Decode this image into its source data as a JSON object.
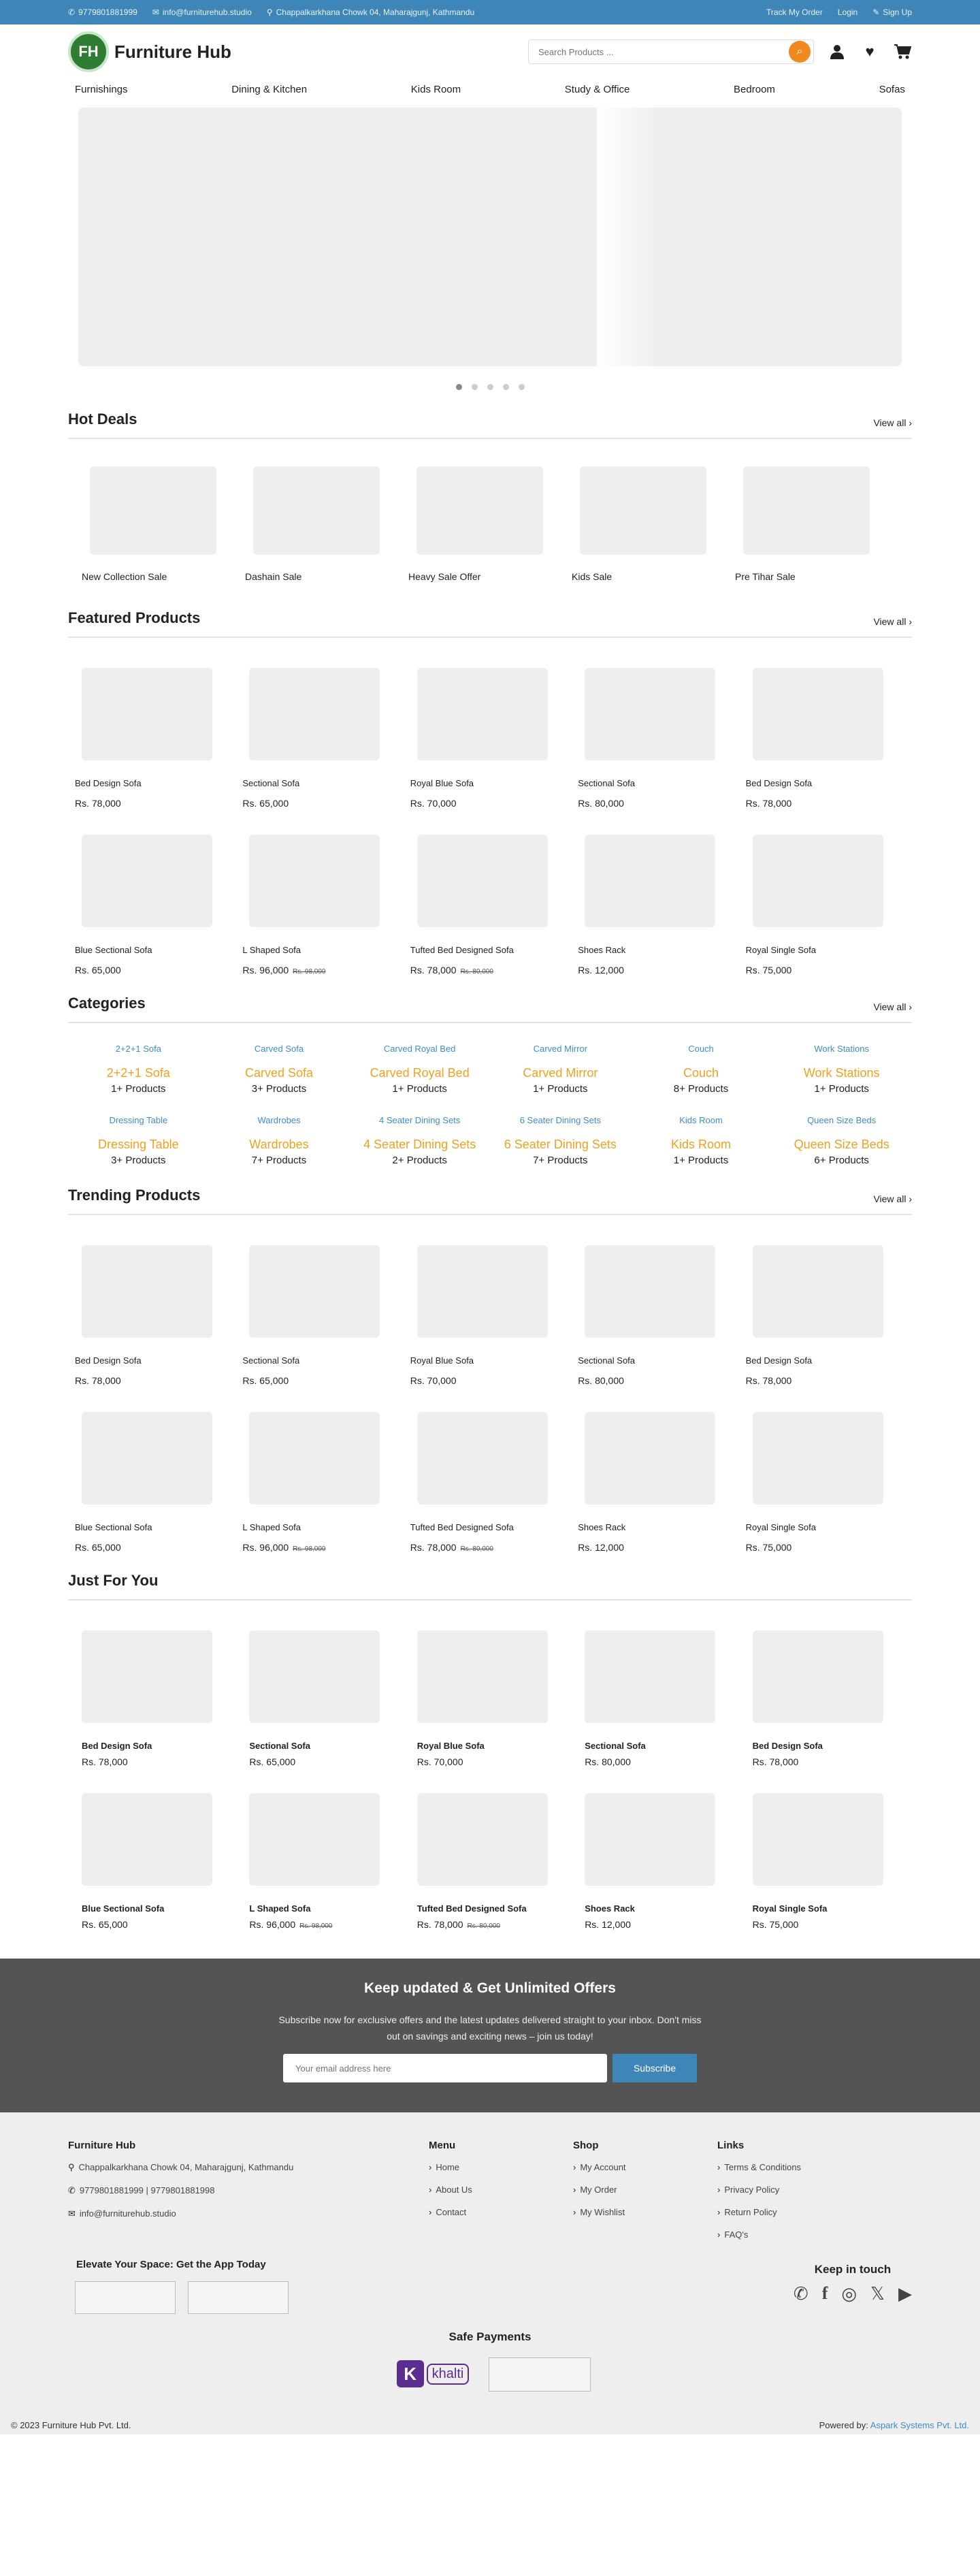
{
  "topbar": {
    "phone": "9779801881999",
    "email": "info@furniturehub.studio",
    "address": "Chappalkarkhana Chowk 04, Maharajgunj, Kathmandu",
    "track": "Track My Order",
    "login": "Login",
    "signup": "Sign Up"
  },
  "header": {
    "logo_mark": "FH",
    "logo_text": "Furniture Hub",
    "search_placeholder": "Search Products ..."
  },
  "nav": [
    "Furnishings",
    "Dining & Kitchen",
    "Kids Room",
    "Study & Office",
    "Bedroom",
    "Sofas"
  ],
  "hot_deals": {
    "title": "Hot Deals",
    "view_all": "View all",
    "items": [
      "New Collection Sale",
      "Dashain Sale",
      "Heavy Sale Offer",
      "Kids Sale",
      "Pre Tihar Sale"
    ]
  },
  "featured": {
    "title": "Featured Products",
    "view_all": "View all",
    "items": [
      {
        "name": "Bed Design Sofa",
        "price": "Rs. 78,000",
        "old": ""
      },
      {
        "name": "Sectional Sofa",
        "price": "Rs. 65,000",
        "old": ""
      },
      {
        "name": "Royal Blue Sofa",
        "price": "Rs. 70,000",
        "old": ""
      },
      {
        "name": "Sectional Sofa",
        "price": "Rs. 80,000",
        "old": ""
      },
      {
        "name": "Bed Design Sofa",
        "price": "Rs. 78,000",
        "old": ""
      },
      {
        "name": "Blue Sectional Sofa",
        "price": "Rs. 65,000",
        "old": ""
      },
      {
        "name": "L Shaped Sofa",
        "price": "Rs. 96,000",
        "old": "Rs. 98,000"
      },
      {
        "name": "Tufted Bed Designed Sofa",
        "price": "Rs. 78,000",
        "old": "Rs. 80,000"
      },
      {
        "name": "Shoes Rack",
        "price": "Rs. 12,000",
        "old": ""
      },
      {
        "name": "Royal Single Sofa",
        "price": "Rs. 75,000",
        "old": ""
      }
    ]
  },
  "categories": {
    "title": "Categories",
    "view_all": "View all",
    "items": [
      {
        "name": "2+2+1 Sofa",
        "count": "1+ Products"
      },
      {
        "name": "Carved Sofa",
        "count": "3+ Products"
      },
      {
        "name": "Carved Royal Bed",
        "count": "1+ Products"
      },
      {
        "name": "Carved Mirror",
        "count": "1+ Products"
      },
      {
        "name": "Couch",
        "count": "8+ Products"
      },
      {
        "name": "Work Stations",
        "count": "1+ Products"
      },
      {
        "name": "Dressing Table",
        "count": "3+ Products"
      },
      {
        "name": "Wardrobes",
        "count": "7+ Products"
      },
      {
        "name": "4 Seater Dining Sets",
        "count": "2+ Products"
      },
      {
        "name": "6 Seater Dining Sets",
        "count": "7+ Products"
      },
      {
        "name": "Kids Room",
        "count": "1+ Products"
      },
      {
        "name": "Queen Size Beds",
        "count": "6+ Products"
      }
    ]
  },
  "trending": {
    "title": "Trending Products",
    "view_all": "View all",
    "items": [
      {
        "name": "Bed Design Sofa",
        "price": "Rs. 78,000",
        "old": ""
      },
      {
        "name": "Sectional Sofa",
        "price": "Rs. 65,000",
        "old": ""
      },
      {
        "name": "Royal Blue Sofa",
        "price": "Rs. 70,000",
        "old": ""
      },
      {
        "name": "Sectional Sofa",
        "price": "Rs. 80,000",
        "old": ""
      },
      {
        "name": "Bed Design Sofa",
        "price": "Rs. 78,000",
        "old": ""
      },
      {
        "name": "Blue Sectional Sofa",
        "price": "Rs. 65,000",
        "old": ""
      },
      {
        "name": "L Shaped Sofa",
        "price": "Rs. 96,000",
        "old": "Rs. 98,000"
      },
      {
        "name": "Tufted Bed Designed Sofa",
        "price": "Rs. 78,000",
        "old": "Rs. 80,000"
      },
      {
        "name": "Shoes Rack",
        "price": "Rs. 12,000",
        "old": ""
      },
      {
        "name": "Royal Single Sofa",
        "price": "Rs. 75,000",
        "old": ""
      }
    ]
  },
  "just_for_you": {
    "title": "Just For You",
    "items": [
      {
        "name": "Bed Design Sofa",
        "price": "Rs. 78,000",
        "old": ""
      },
      {
        "name": "Sectional Sofa",
        "price": "Rs. 65,000",
        "old": ""
      },
      {
        "name": "Royal Blue Sofa",
        "price": "Rs. 70,000",
        "old": ""
      },
      {
        "name": "Sectional Sofa",
        "price": "Rs. 80,000",
        "old": ""
      },
      {
        "name": "Bed Design Sofa",
        "price": "Rs. 78,000",
        "old": ""
      },
      {
        "name": "Blue Sectional Sofa",
        "price": "Rs. 65,000",
        "old": ""
      },
      {
        "name": "L Shaped Sofa",
        "price": "Rs. 96,000",
        "old": "Rs. 98,000"
      },
      {
        "name": "Tufted Bed Designed Sofa",
        "price": "Rs. 78,000",
        "old": "Rs. 80,000"
      },
      {
        "name": "Shoes Rack",
        "price": "Rs. 12,000",
        "old": ""
      },
      {
        "name": "Royal Single Sofa",
        "price": "Rs. 75,000",
        "old": ""
      }
    ]
  },
  "newsletter": {
    "title": "Keep updated & Get Unlimited Offers",
    "text": "Subscribe now for exclusive offers and the latest updates delivered straight to your inbox. Don't miss out on savings and exciting news – join us today!",
    "placeholder": "Your email address here",
    "button": "Subscribe"
  },
  "footer": {
    "brand": "Furniture Hub",
    "address": "Chappalkarkhana Chowk 04, Maharajgunj, Kathmandu",
    "phones": "9779801881999  | 9779801881998",
    "email": "info@furniturehub.studio",
    "menu_title": "Menu",
    "menu": [
      "Home",
      "About Us",
      "Contact"
    ],
    "shop_title": "Shop",
    "shop": [
      "My Account",
      "My Order",
      "My Wishlist"
    ],
    "links_title": "Links",
    "links": [
      "Terms & Conditions",
      "Privacy Policy",
      "Return Policy",
      "FAQ's"
    ],
    "app_title": "Elevate Your Space: Get the App Today",
    "keep_title": "Keep in touch",
    "safe_title": "Safe Payments",
    "khalti": "khalti",
    "copyright": "© 2023 Furniture Hub Pvt. Ltd.",
    "powered_prefix": "Powered by:",
    "powered_by": "Aspark Systems Pvt. Ltd."
  },
  "colors": {
    "topbar": "#3e86b8",
    "accent": "#f2891f",
    "category_name": "#f2a01f",
    "newsletter_bg": "#545454",
    "footer_bg": "#eeeeee"
  }
}
